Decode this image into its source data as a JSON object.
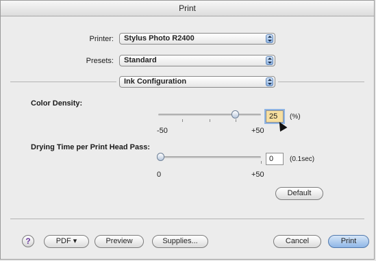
{
  "window": {
    "title": "Print"
  },
  "printer": {
    "label": "Printer:",
    "value": "Stylus Photo R2400"
  },
  "presets": {
    "label": "Presets:",
    "value": "Standard"
  },
  "panel": {
    "value": "Ink Configuration"
  },
  "color_density": {
    "label": "Color Density:",
    "value": "25",
    "unit": "(%)",
    "min_label": "-50",
    "max_label": "+50",
    "slider_fraction": 0.75
  },
  "drying_time": {
    "label": "Drying Time per Print Head Pass:",
    "value": "0",
    "unit": "(0.1sec)",
    "min_label": "0",
    "max_label": "+50",
    "slider_fraction": 0.0
  },
  "buttons": {
    "default": "Default",
    "help": "?",
    "pdf": "PDF ▾",
    "preview": "Preview",
    "supplies": "Supplies...",
    "cancel": "Cancel",
    "print": "Print"
  }
}
